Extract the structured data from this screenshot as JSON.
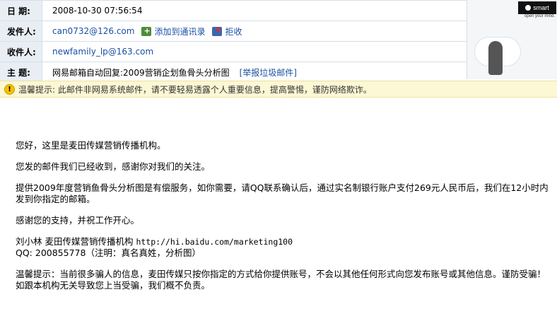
{
  "header": {
    "date_label": "日  期:",
    "date": "2008-10-30 07:56:54",
    "from_label": "发件人:",
    "from": "can0732@126.com",
    "add_contact": "添加到通讯录",
    "reject": "拒收",
    "to_label": "收件人:",
    "to": "newfamily_lp@163.com",
    "subject_label": "主  题:",
    "subject": "网易邮箱自动回复:2009营销企划鱼骨头分析图",
    "report_spam": "[举报垃圾邮件]"
  },
  "ad": {
    "brand": "smart",
    "tagline": "open your mind."
  },
  "warning": {
    "icon": "warning-icon",
    "text": "温馨提示: 此邮件非网易系统邮件，请不要轻易透露个人重要信息，提高警惕，谨防网络欺诈。"
  },
  "message": {
    "greeting": "您好，这里是麦田传媒营销传播机构。",
    "received": "您发的邮件我们已经收到，感谢你对我们的关注。",
    "offer": "提供2009年度营销鱼骨头分析图是有偿服务，如你需要，请QQ联系确认后，通过实名制银行账户支付269元人民币后，我们在12小时内发到你指定的邮箱。",
    "thanks": "感谢您的支持，并祝工作开心。",
    "sig_name": "刘小林  麦田传媒营销传播机构 ",
    "sig_url": "http://hi.baidu.com/marketing100",
    "sig_qq": "QQ: 200855778（注明：真名真姓，分析图）",
    "notice": "温馨提示：当前很多骗人的信息，麦田传媒只按你指定的方式给你提供账号，不会以其他任何形式向您发布账号或其他信息。谨防受骗！如跟本机构无关导致您上当受骗，我们概不负责。"
  }
}
